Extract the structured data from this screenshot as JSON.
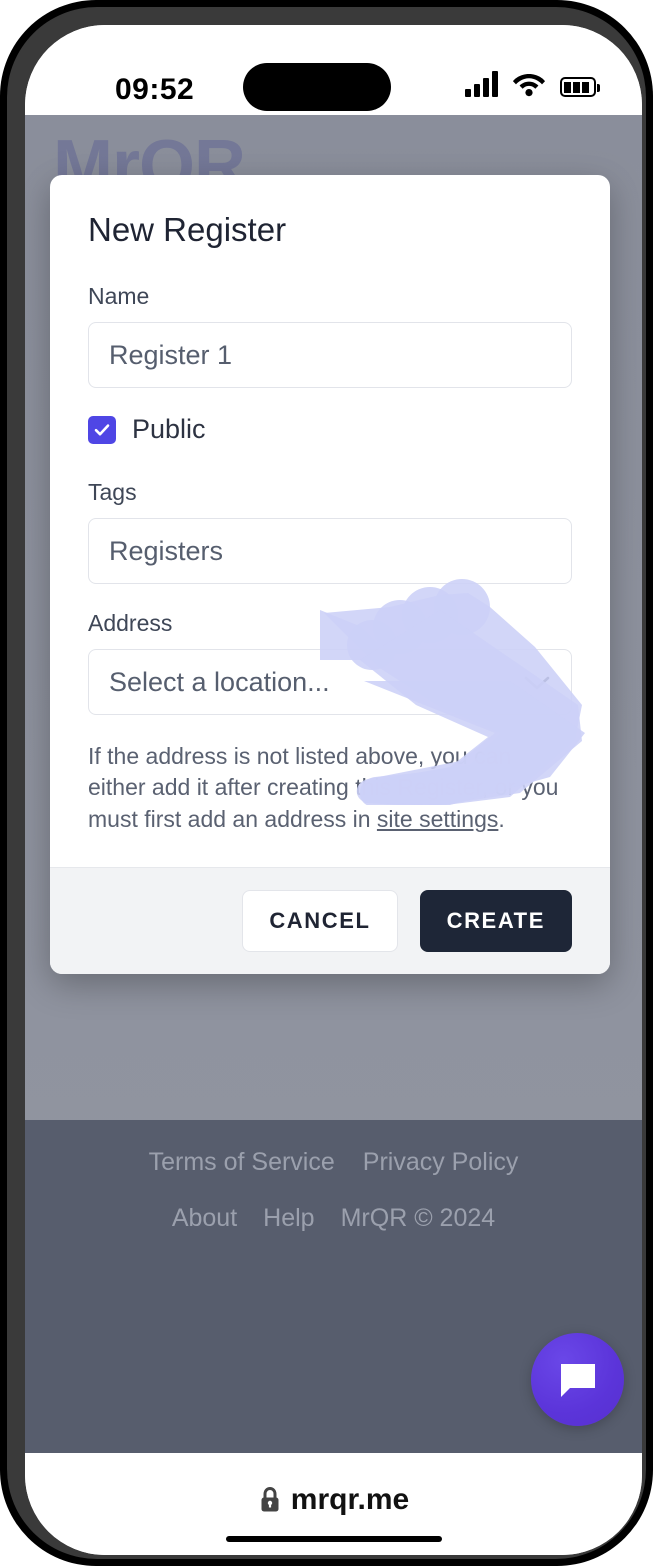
{
  "status_bar": {
    "time": "09:52",
    "icons": [
      "cellular-signal-icon",
      "wifi-icon",
      "battery-icon"
    ]
  },
  "browser": {
    "lock_icon": "lock-icon",
    "url": "mrqr.me"
  },
  "page": {
    "brand": "MrQR"
  },
  "modal": {
    "title": "New Register",
    "fields": {
      "name": {
        "label": "Name",
        "value": "Register 1",
        "placeholder": "Register 1"
      },
      "public": {
        "label": "Public",
        "checked": true,
        "checkbox_color": "#4f46e5"
      },
      "tags": {
        "label": "Tags",
        "value": "Registers",
        "placeholder": "Registers"
      },
      "address": {
        "label": "Address",
        "value": "Select a location...",
        "placeholder": "Select a location...",
        "chevron_icon": "chevron-down-icon"
      }
    },
    "helper_text_before": "If the address is not listed above, you can either add it after creating this Register, or you must first add an address in ",
    "helper_link": "site settings",
    "helper_text_after": ".",
    "actions": {
      "cancel_label": "CANCEL",
      "create_label": "CREATE",
      "create_color": "#1e2637"
    }
  },
  "footer": {
    "row1": [
      {
        "label": "Terms of Service"
      },
      {
        "label": "Privacy Policy"
      }
    ],
    "row2": [
      {
        "label": "About"
      },
      {
        "label": "Help"
      }
    ],
    "copyright": "MrQR © 2024"
  },
  "chat_fab": {
    "icon": "chat-bubble-icon",
    "color": "#5b34d9"
  },
  "cursor": {
    "icon": "hand-pointer-cursor",
    "color": "#ccd0f7"
  }
}
